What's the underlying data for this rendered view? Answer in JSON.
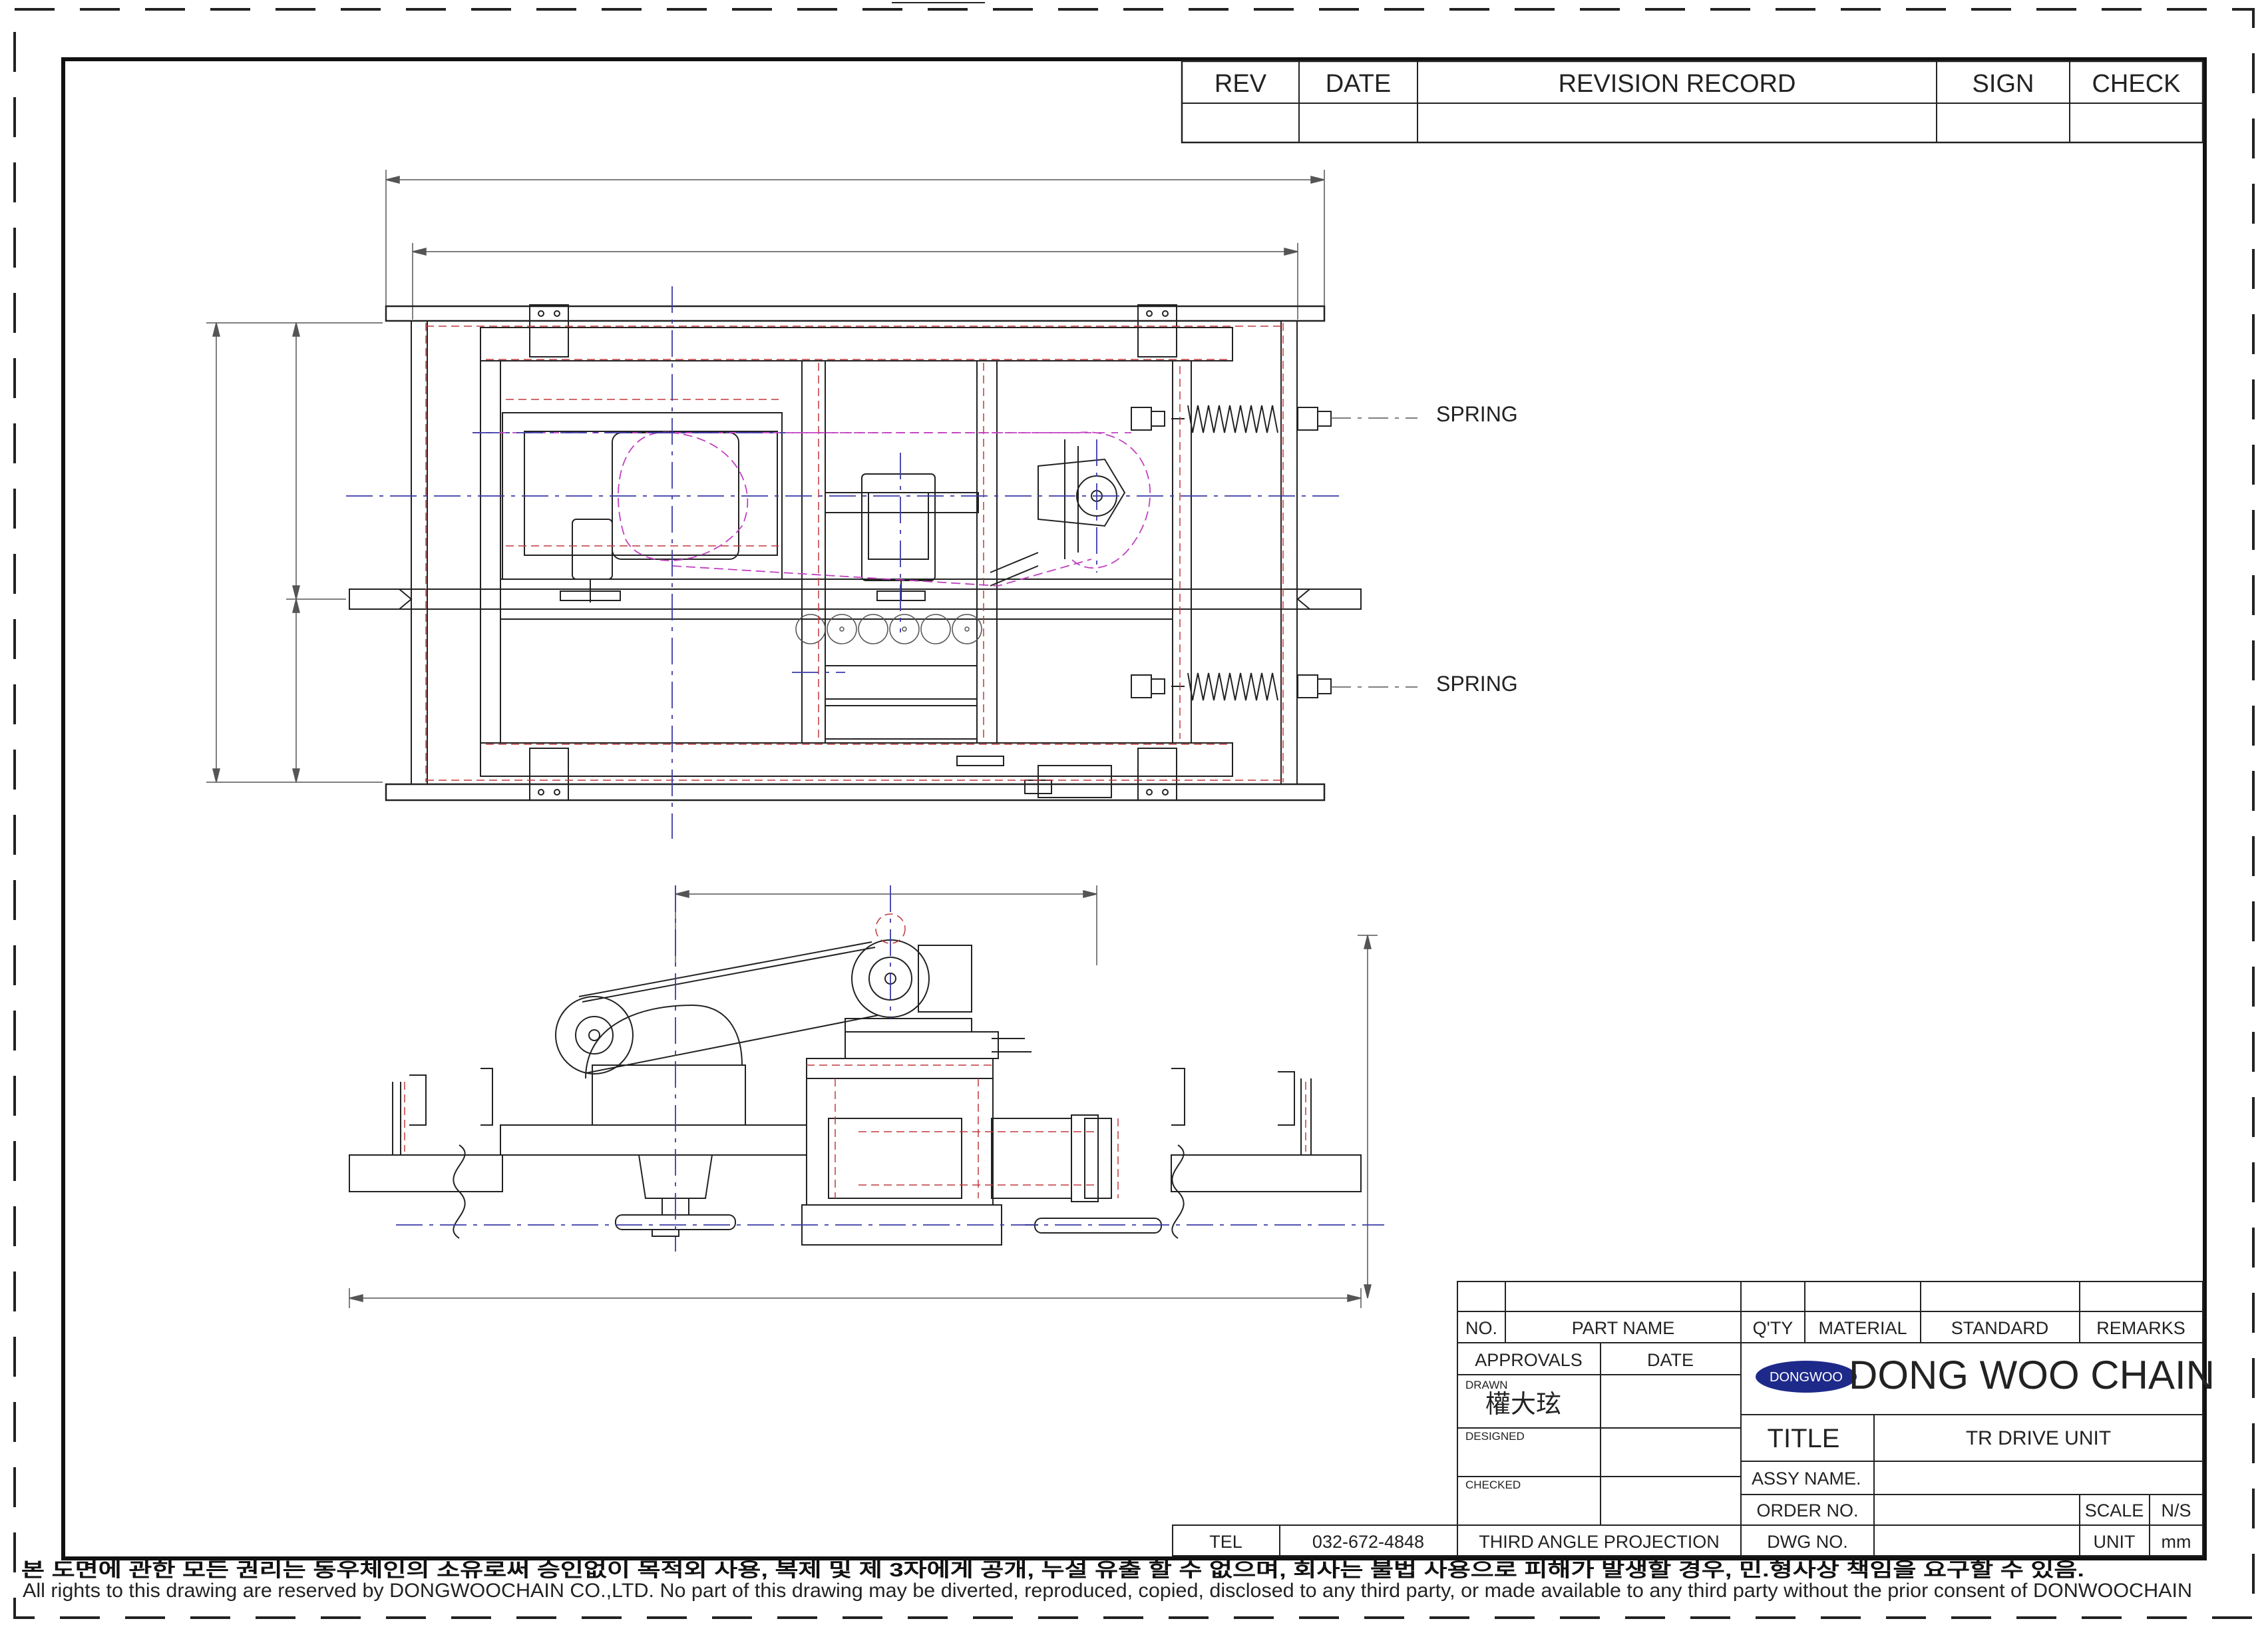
{
  "revision_block": {
    "headers": [
      "REV",
      "DATE",
      "REVISION RECORD",
      "SIGN",
      "CHECK"
    ]
  },
  "callouts": {
    "spring_upper": "SPRING",
    "spring_lower": "SPRING"
  },
  "title_block": {
    "parts_headers": {
      "no": "NO.",
      "part_name": "PART NAME",
      "qty": "Q'TY",
      "material": "MATERIAL",
      "standard": "STANDARD",
      "remarks": "REMARKS"
    },
    "approvals_label": "APPROVALS",
    "date_label": "DATE",
    "drawn_label": "DRAWN",
    "drawn_by": "權大玹",
    "designed_label": "DESIGNED",
    "checked_label": "CHECKED",
    "company_logo_text": "DONGWOO",
    "company_name": "DONG WOO CHAIN",
    "title_label": "TITLE",
    "title_value": "TR DRIVE UNIT",
    "assy_name_label": "ASSY NAME.",
    "order_no_label": "ORDER NO.",
    "dwg_no_label": "DWG NO.",
    "scale_label": "SCALE",
    "scale_value": "N/S",
    "unit_label": "UNIT",
    "unit_value": "mm",
    "tel_label": "TEL",
    "tel_value": "032-672-4848",
    "projection": "THIRD ANGLE PROJECTION"
  },
  "footer": {
    "korean_notice": "본 도면에 관한 모든 권리는 동우체인의 소유로써 승인없이 목적외 사용, 복제 및 제 3자에게 공개, 누설 유출 할 수 없으며, 회사는 불법 사용으로 피해가 발생할 경우, 민.형사상 책임을 요구할 수 있음.",
    "english_notice": "All rights to this drawing are reserved by DONGWOOCHAIN CO.,LTD. No part of this drawing may be diverted, reproduced, copied, disclosed to any third party, or made available to any third party without the prior consent of DONWOOCHAIN"
  },
  "colors": {
    "line": "#222222",
    "hidden_red": "#c0393b",
    "centerline_blue": "#3a3aa8",
    "chain_magenta": "#c040c0",
    "logo_navy": "#1e2a8a"
  }
}
